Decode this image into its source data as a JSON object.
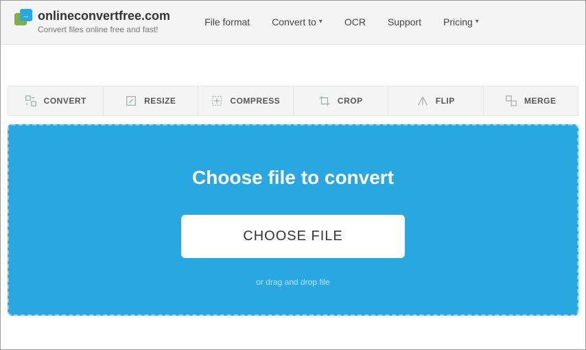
{
  "header": {
    "site_name": "onlineconvertfree.com",
    "tagline": "Convert files online free and fast!"
  },
  "nav": {
    "file_format": "File format",
    "convert_to": "Convert to",
    "ocr": "OCR",
    "support": "Support",
    "pricing": "Pricing"
  },
  "tabs": {
    "convert": "CONVERT",
    "resize": "RESIZE",
    "compress": "COMPRESS",
    "crop": "CROP",
    "flip": "FLIP",
    "merge": "MERGE"
  },
  "dropzone": {
    "title": "Choose file to convert",
    "button": "CHOOSE FILE",
    "hint": "or drag and drop file"
  }
}
